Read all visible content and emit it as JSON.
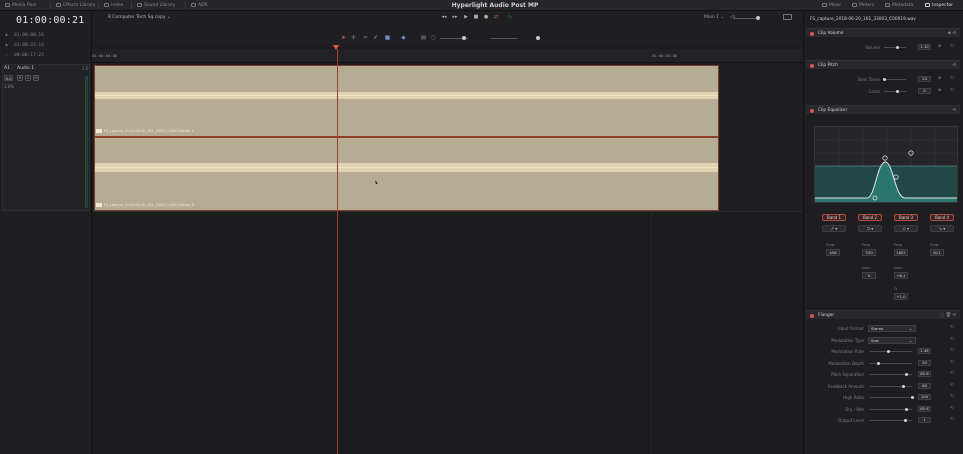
{
  "topbar": {
    "items": [
      "Media Pool",
      "Effects Library",
      "Index",
      "Sound Library",
      "ADR"
    ],
    "title": "Hyperlight Audio Post MP",
    "right_items": [
      "Mixer",
      "Meters",
      "Metadata",
      "Inspector"
    ]
  },
  "left": {
    "timecode": "01:00:00:21",
    "rows": [
      {
        "icon": "●",
        "value": "01:00:00:16"
      },
      {
        "icon": "●",
        "value": "01:00:23:16"
      },
      {
        "icon": "○",
        "value": "00:00:17:23"
      }
    ],
    "track": {
      "id": "A1",
      "name": "Audio 1",
      "channels": "2.0",
      "volume": "0.0",
      "buttons": [
        "R",
        "S",
        "M"
      ],
      "format": "1.0%"
    }
  },
  "header": {
    "project": "8 Computer Tech Sq copy",
    "monitor": "Main 1"
  },
  "ruler": {
    "start": "01:00:00:00",
    "mark": "01:00:30:00"
  },
  "clips": {
    "top": "FS_capture_2018-06-20_161_33003_C000-Stereo-1",
    "bottom": "FS_capture_2018-06-20_161_33003_C000-Stereo-R"
  },
  "inspector": {
    "file": "FS_capture_2018-06-20_161_33003_C00019.wav",
    "clip_volume": {
      "title": "Clip Volume",
      "label": "Volume",
      "value": "1.10",
      "level": 0.62
    },
    "clip_pitch": {
      "title": "Clip Pitch",
      "semi_label": "Semi Tones",
      "semi_value": "24",
      "semi_level": 0.03,
      "cents_label": "Cents",
      "cents_value": "0",
      "cents_level": 0.62
    },
    "clip_eq": {
      "title": "Clip Equalizer",
      "bands": [
        {
          "name": "Band 1",
          "type": "↗ ▾"
        },
        {
          "name": "Band 2",
          "type": "⊐ ▾"
        },
        {
          "name": "Band 3",
          "type": "◇ ▾"
        },
        {
          "name": "Band 4",
          "type": "↘ ▾"
        }
      ],
      "freq_label": "Freq",
      "gain_label": "Gain",
      "q_label": "Q",
      "freqs": [
        "458",
        "330",
        "1807",
        "811"
      ],
      "gains": [
        "0",
        "+6.1"
      ],
      "q": "+1.0"
    },
    "flanger": {
      "title": "Flanger",
      "params": [
        {
          "label": "Input Format",
          "type": "dropdown",
          "value": "Stereo"
        },
        {
          "label": "Modulation Type",
          "type": "dropdown",
          "value": "Saw"
        },
        {
          "label": "Modulation Rate",
          "type": "slider",
          "value": "1.46",
          "level": 0.44
        },
        {
          "label": "Modulation Depth",
          "type": "slider",
          "value": "20",
          "level": 0.2
        },
        {
          "label": "Pitch Separation",
          "type": "slider",
          "value": "85.6",
          "level": 0.86
        },
        {
          "label": "Feedback Amount",
          "type": "slider",
          "value": "60",
          "level": 0.8
        },
        {
          "label": "High Ratio",
          "type": "slider",
          "value": "100",
          "level": 1.0
        },
        {
          "label": "Dry / Wet",
          "type": "slider",
          "value": "85.6",
          "level": 0.86
        },
        {
          "label": "Output Level",
          "type": "slider",
          "value": "1",
          "level": 0.85
        }
      ]
    }
  }
}
